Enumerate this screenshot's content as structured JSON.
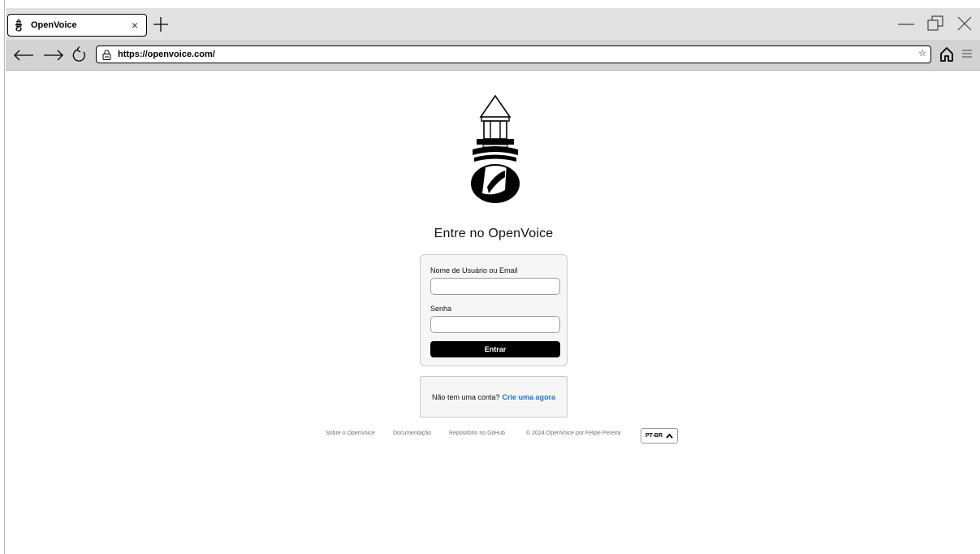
{
  "browser": {
    "tab_title": "OpenVoice",
    "tab_close": "×",
    "url": "https://openvoice.com/",
    "bookmark_star": "☆"
  },
  "page": {
    "heading": "Entre no OpenVoice",
    "login": {
      "username_label": "Nome de Usuário ou Email",
      "username_value": "",
      "password_label": "Senha",
      "password_value": "",
      "submit_label": "Entrar"
    },
    "signup": {
      "prompt": "Não tem uma conta?",
      "link_label": "Crie uma agora"
    },
    "footer": {
      "about": "Sobre o OpenVoice",
      "docs": "Documentação",
      "repo": "Repositório no GitHub",
      "copyright": "© 2024 OpenVoice por Felipe Pereira",
      "language": "PT-BR"
    }
  },
  "colors": {
    "link": "#1f74d8",
    "button_bg": "#000000",
    "tabstrip_bg": "#e1e1e1",
    "navbar_bg": "#d3d3d3"
  },
  "icons": [
    "lighthouse-icon",
    "plus-icon",
    "minimize-icon",
    "restore-icon",
    "close-icon",
    "back-arrow-icon",
    "forward-arrow-icon",
    "reload-icon",
    "lock-icon",
    "star-icon",
    "home-icon",
    "menu-icon",
    "chevron-up-icon"
  ]
}
